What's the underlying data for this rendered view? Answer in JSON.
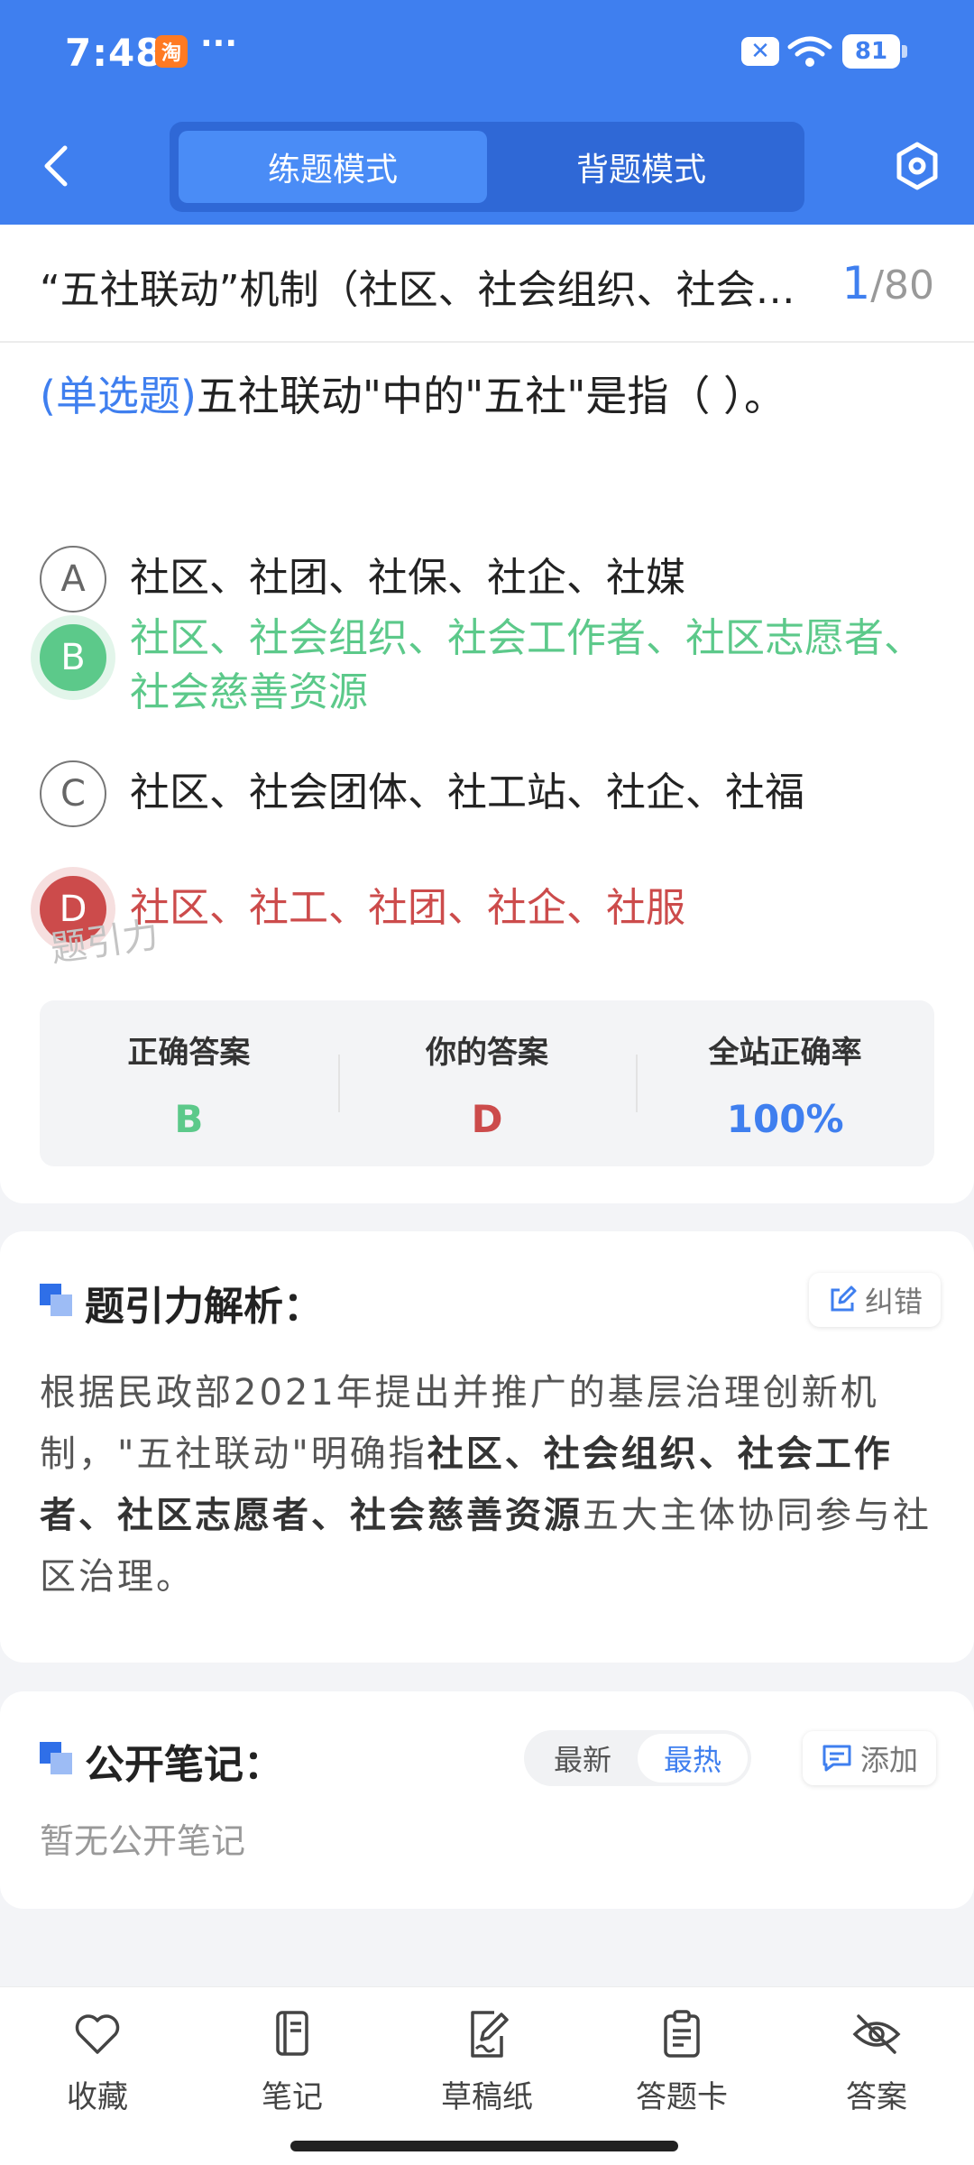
{
  "status_bar": {
    "time": "7:48",
    "taobao_icon_text": "淘",
    "more": "···",
    "battery": "81"
  },
  "header": {
    "tabs": [
      "练题模式",
      "背题模式"
    ],
    "active_tab": 0
  },
  "question": {
    "title": "“五社联动”机制（社区、社会组织、社会工作者、社区志愿者、社会慈善资源）",
    "current": "1",
    "total": "/80",
    "type": "(单选题)",
    "text": "五社联动\"中的\"五社\"是指（        ）。",
    "options": [
      {
        "letter": "A",
        "text": "社区、社团、社保、社企、社媒",
        "state": "normal"
      },
      {
        "letter": "B",
        "text": "社区、社会组织、社会工作者、社区志愿者、社会慈善资源",
        "state": "correct"
      },
      {
        "letter": "C",
        "text": "社区、社会团体、社工站、社企、社福",
        "state": "normal"
      },
      {
        "letter": "D",
        "text": "社区、社工、社团、社企、社服",
        "state": "wrong"
      }
    ],
    "stats": {
      "correct_label": "正确答案",
      "correct_value": "B",
      "yours_label": "你的答案",
      "yours_value": "D",
      "rate_label": "全站正确率",
      "rate_value": "100%"
    },
    "watermark": "题引力"
  },
  "analysis": {
    "title": "题引力解析：",
    "report_label": "纠错",
    "text_parts": [
      {
        "t": "根据民政部2021年提出并推广的基层治理创新机制，\"五社联动\"明确指",
        "bold": false
      },
      {
        "t": "社区、社会组织、社会工作者、社区志愿者、社会慈善资源",
        "bold": true
      },
      {
        "t": "五大主体协同参与社区治理。",
        "bold": false
      }
    ]
  },
  "notes": {
    "title": "公开笔记：",
    "sort_options": [
      "最新",
      "最热"
    ],
    "active_sort": 1,
    "add_label": "添加",
    "empty_text": "暂无公开笔记"
  },
  "bottom_bar": {
    "tabs": [
      {
        "label": "收藏",
        "icon": "heart-icon"
      },
      {
        "label": "笔记",
        "icon": "notebook-icon"
      },
      {
        "label": "草稿纸",
        "icon": "draft-icon"
      },
      {
        "label": "答题卡",
        "icon": "answer-card-icon"
      },
      {
        "label": "答案",
        "icon": "eye-off-icon"
      }
    ]
  },
  "colors": {
    "primary": "#3f7fef",
    "correct": "#5cc98a",
    "wrong": "#cc4b4b"
  }
}
